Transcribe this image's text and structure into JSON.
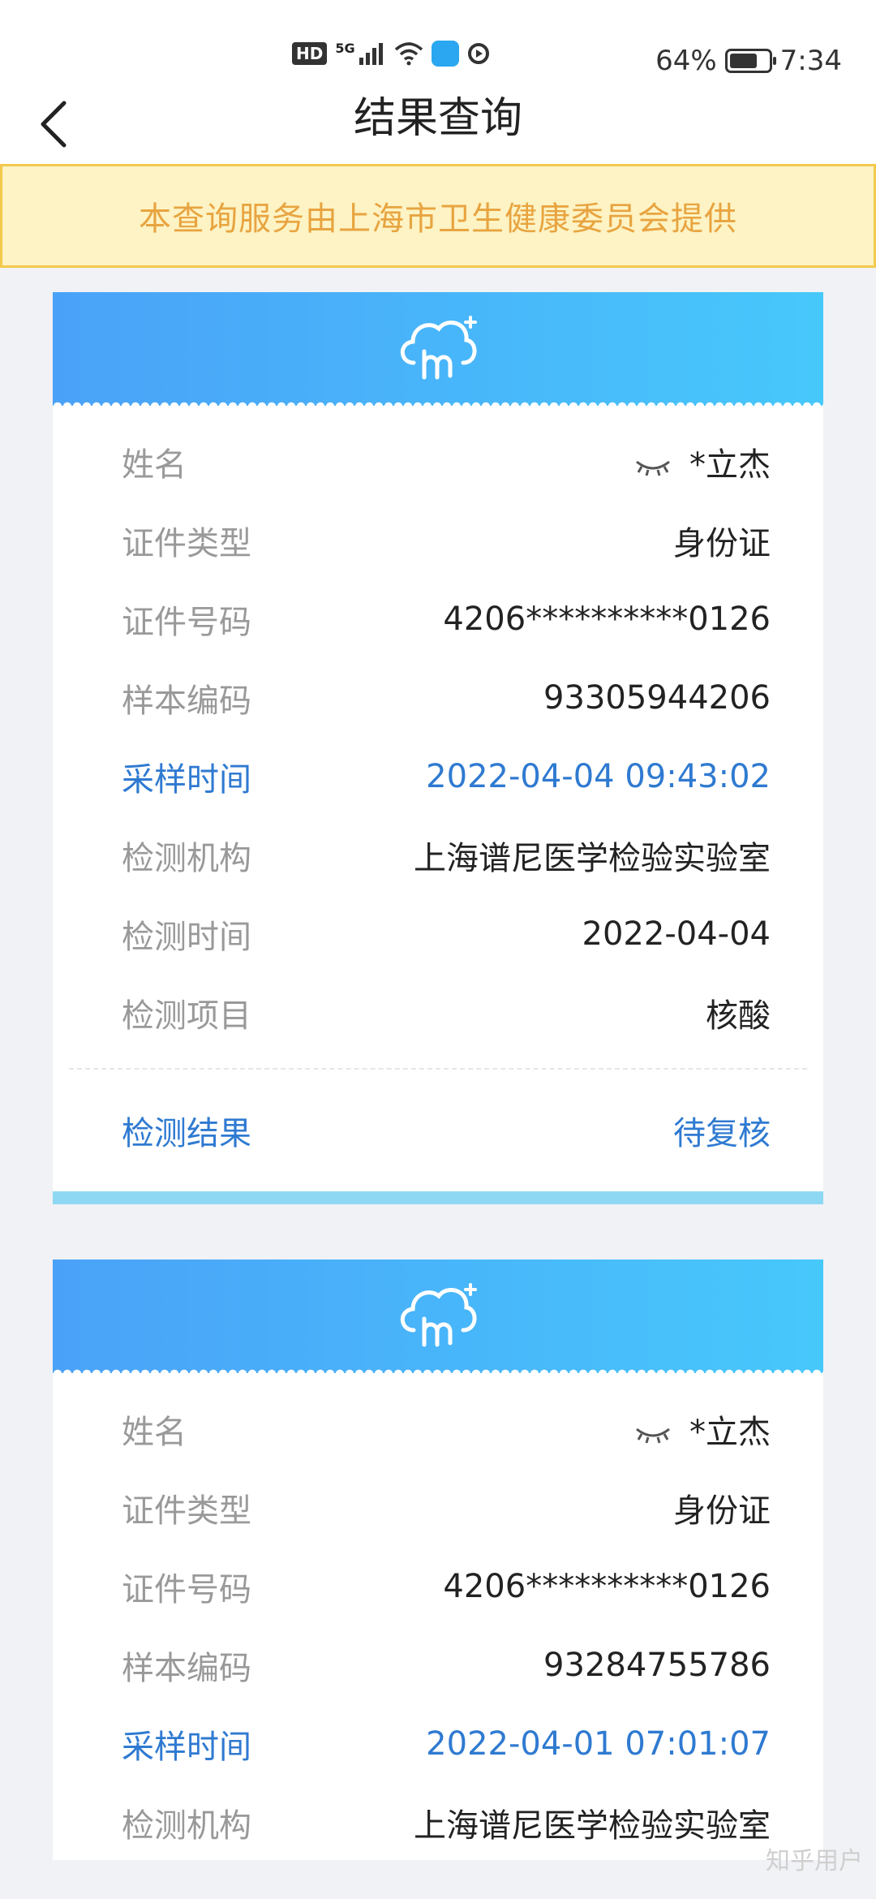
{
  "status_bar": {
    "hd": "HD",
    "network": "5G",
    "battery_percent": "64%",
    "battery_level": 0.64,
    "time": "7:34"
  },
  "nav": {
    "title": "结果查询"
  },
  "notice": {
    "text": "本查询服务由上海市卫生健康委员会提供"
  },
  "cards": [
    {
      "rows": [
        {
          "label": "姓名",
          "value": "*立杰"
        },
        {
          "label": "证件类型",
          "value": "身份证"
        },
        {
          "label": "证件号码",
          "value": "4206**********0126"
        },
        {
          "label": "样本编码",
          "value": "93305944206"
        },
        {
          "label": "采样时间",
          "value": "2022-04-04 09:43:02"
        },
        {
          "label": "检测机构",
          "value": "上海谱尼医学检验实验室"
        },
        {
          "label": "检测时间",
          "value": "2022-04-04"
        },
        {
          "label": "检测项目",
          "value": "核酸"
        }
      ],
      "result": {
        "label": "检测结果",
        "value": "待复核"
      }
    },
    {
      "rows": [
        {
          "label": "姓名",
          "value": "*立杰"
        },
        {
          "label": "证件类型",
          "value": "身份证"
        },
        {
          "label": "证件号码",
          "value": "4206**********0126"
        },
        {
          "label": "样本编码",
          "value": "93284755786"
        },
        {
          "label": "采样时间",
          "value": "2022-04-01 07:01:07"
        },
        {
          "label": "检测机构",
          "value": "上海谱尼医学检验实验室"
        }
      ]
    }
  ],
  "watermark": "知乎用户",
  "colors": {
    "accent_blue": "#2f7ad1",
    "notice_bg": "#fdf3c4",
    "notice_text": "#e8a440"
  }
}
